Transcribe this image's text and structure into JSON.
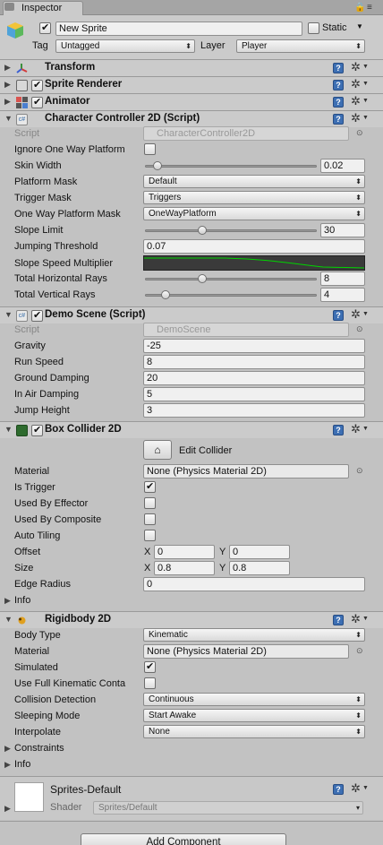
{
  "tab": {
    "label": "Inspector"
  },
  "header": {
    "object_name": "New Sprite",
    "static_label": "Static",
    "tag_label": "Tag",
    "tag_value": "Untagged",
    "layer_label": "Layer",
    "layer_value": "Player"
  },
  "components": {
    "transform": {
      "title": "Transform"
    },
    "sprite_renderer": {
      "title": "Sprite Renderer"
    },
    "animator": {
      "title": "Animator"
    },
    "cc2d": {
      "title": "Character Controller 2D (Script)",
      "script_label": "Script",
      "script_value": "CharacterController2D",
      "ignore_oneway_label": "Ignore One Way Platform",
      "skin_width_label": "Skin Width",
      "skin_width_value": "0.02",
      "platform_mask_label": "Platform Mask",
      "platform_mask_value": "Default",
      "trigger_mask_label": "Trigger Mask",
      "trigger_mask_value": "Triggers",
      "oneway_mask_label": "One Way Platform Mask",
      "oneway_mask_value": "OneWayPlatform",
      "slope_limit_label": "Slope Limit",
      "slope_limit_value": "30",
      "jumping_threshold_label": "Jumping Threshold",
      "jumping_threshold_value": "0.07",
      "slope_speed_label": "Slope Speed Multiplier",
      "total_h_rays_label": "Total Horizontal Rays",
      "total_h_rays_value": "8",
      "total_v_rays_label": "Total Vertical Rays",
      "total_v_rays_value": "4"
    },
    "demo": {
      "title": "Demo Scene (Script)",
      "script_label": "Script",
      "script_value": "DemoScene",
      "gravity_label": "Gravity",
      "gravity_value": "-25",
      "run_speed_label": "Run Speed",
      "run_speed_value": "8",
      "ground_damping_label": "Ground Damping",
      "ground_damping_value": "20",
      "in_air_damping_label": "In Air Damping",
      "in_air_damping_value": "5",
      "jump_height_label": "Jump Height",
      "jump_height_value": "3"
    },
    "box": {
      "title": "Box Collider 2D",
      "edit_collider_label": "Edit Collider",
      "material_label": "Material",
      "material_value": "None (Physics Material 2D)",
      "is_trigger_label": "Is Trigger",
      "used_by_effector_label": "Used By Effector",
      "used_by_composite_label": "Used By Composite",
      "auto_tiling_label": "Auto Tiling",
      "offset_label": "Offset",
      "offset_x": "0",
      "offset_y": "0",
      "size_label": "Size",
      "size_x": "0.8",
      "size_y": "0.8",
      "x_label": "X",
      "y_label": "Y",
      "edge_radius_label": "Edge Radius",
      "edge_radius_value": "0",
      "info_label": "Info"
    },
    "rb": {
      "title": "Rigidbody 2D",
      "body_type_label": "Body Type",
      "body_type_value": "Kinematic",
      "material_label": "Material",
      "material_value": "None (Physics Material 2D)",
      "simulated_label": "Simulated",
      "full_kinematic_label": "Use Full Kinematic Conta",
      "collision_detection_label": "Collision Detection",
      "collision_detection_value": "Continuous",
      "sleeping_mode_label": "Sleeping Mode",
      "sleeping_mode_value": "Start Awake",
      "interpolate_label": "Interpolate",
      "interpolate_value": "None",
      "constraints_label": "Constraints",
      "info_label": "Info"
    },
    "material_section": {
      "name": "Sprites-Default",
      "shader_label": "Shader",
      "shader_value": "Sprites/Default"
    }
  },
  "add_component_label": "Add Component",
  "icons": {
    "help": "?",
    "gear": "✲",
    "dropdown": "▾",
    "fold_closed": "▶",
    "fold_open": "▼",
    "picker": "⊙"
  },
  "colors": {
    "panel": "#c2c2c2",
    "header": "#cbcbcb",
    "help_blue": "#3d6fb3",
    "curve_bg": "#3a3a3a",
    "curve_line": "#00d400"
  }
}
